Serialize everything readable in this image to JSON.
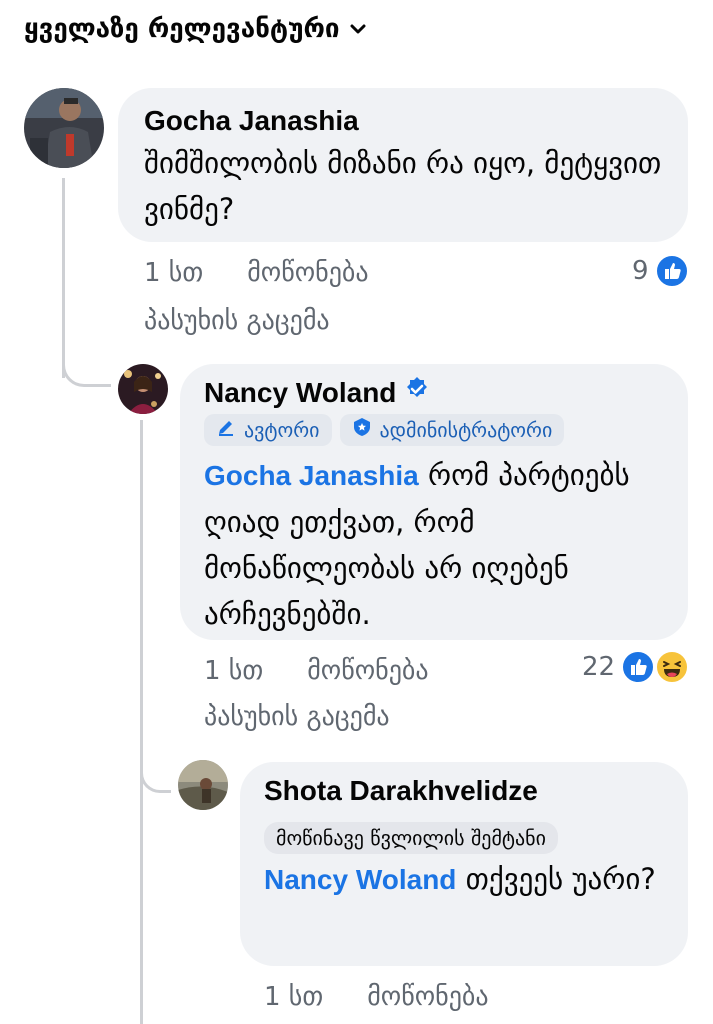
{
  "sort": {
    "label": "ყველაზე რელევანტური"
  },
  "comments": [
    {
      "author": "Gocha Janashia",
      "text": "შიმშილობის მიზანი რა იყო, მეტყვით ვინმე?",
      "time": "1 სთ",
      "like_label": "მოწონება",
      "reply_label": "პასუხის გაცემა",
      "reaction_count": "9"
    },
    {
      "author": "Nancy Woland",
      "verified": true,
      "badges": [
        "ავტორი",
        "ადმინისტრატორი"
      ],
      "mention": "Gocha Janashia",
      "text": "რომ პარტიებს ღიად ეთქვათ, რომ მონაწილეობას არ იღებენ არჩევნებში.",
      "time": "1 სთ",
      "like_label": "მოწონება",
      "reply_label": "პასუხის გაცემა",
      "reaction_count": "22"
    },
    {
      "author": "Shota Darakhvelidze",
      "badges": [
        "მოწინავე წვლილის შემტანი"
      ],
      "mention": "Nancy Woland",
      "text": "თქვეეს უარი?",
      "time": "1 სთ",
      "like_label": "მოწონება"
    }
  ],
  "colors": {
    "link_blue": "#1b74e4",
    "bubble_bg": "#f0f2f5",
    "meta_gray": "#606770",
    "thread_line": "#ced0d4"
  },
  "icons": [
    "chevron-down-icon",
    "verified-badge-icon",
    "pencil-icon",
    "admin-shield-icon",
    "like-reaction-icon",
    "haha-reaction-icon"
  ]
}
